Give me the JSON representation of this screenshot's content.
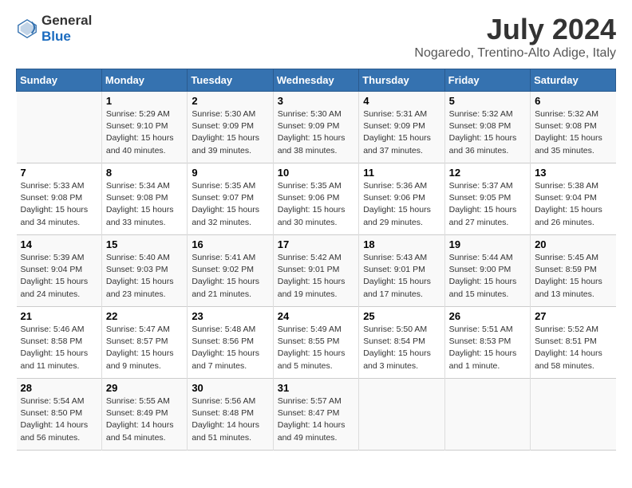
{
  "logo": {
    "general": "General",
    "blue": "Blue"
  },
  "title": "July 2024",
  "subtitle": "Nogaredo, Trentino-Alto Adige, Italy",
  "weekdays": [
    "Sunday",
    "Monday",
    "Tuesday",
    "Wednesday",
    "Thursday",
    "Friday",
    "Saturday"
  ],
  "weeks": [
    [
      {
        "day": "",
        "info": ""
      },
      {
        "day": "1",
        "info": "Sunrise: 5:29 AM\nSunset: 9:10 PM\nDaylight: 15 hours\nand 40 minutes."
      },
      {
        "day": "2",
        "info": "Sunrise: 5:30 AM\nSunset: 9:09 PM\nDaylight: 15 hours\nand 39 minutes."
      },
      {
        "day": "3",
        "info": "Sunrise: 5:30 AM\nSunset: 9:09 PM\nDaylight: 15 hours\nand 38 minutes."
      },
      {
        "day": "4",
        "info": "Sunrise: 5:31 AM\nSunset: 9:09 PM\nDaylight: 15 hours\nand 37 minutes."
      },
      {
        "day": "5",
        "info": "Sunrise: 5:32 AM\nSunset: 9:08 PM\nDaylight: 15 hours\nand 36 minutes."
      },
      {
        "day": "6",
        "info": "Sunrise: 5:32 AM\nSunset: 9:08 PM\nDaylight: 15 hours\nand 35 minutes."
      }
    ],
    [
      {
        "day": "7",
        "info": "Sunrise: 5:33 AM\nSunset: 9:08 PM\nDaylight: 15 hours\nand 34 minutes."
      },
      {
        "day": "8",
        "info": "Sunrise: 5:34 AM\nSunset: 9:08 PM\nDaylight: 15 hours\nand 33 minutes."
      },
      {
        "day": "9",
        "info": "Sunrise: 5:35 AM\nSunset: 9:07 PM\nDaylight: 15 hours\nand 32 minutes."
      },
      {
        "day": "10",
        "info": "Sunrise: 5:35 AM\nSunset: 9:06 PM\nDaylight: 15 hours\nand 30 minutes."
      },
      {
        "day": "11",
        "info": "Sunrise: 5:36 AM\nSunset: 9:06 PM\nDaylight: 15 hours\nand 29 minutes."
      },
      {
        "day": "12",
        "info": "Sunrise: 5:37 AM\nSunset: 9:05 PM\nDaylight: 15 hours\nand 27 minutes."
      },
      {
        "day": "13",
        "info": "Sunrise: 5:38 AM\nSunset: 9:04 PM\nDaylight: 15 hours\nand 26 minutes."
      }
    ],
    [
      {
        "day": "14",
        "info": "Sunrise: 5:39 AM\nSunset: 9:04 PM\nDaylight: 15 hours\nand 24 minutes."
      },
      {
        "day": "15",
        "info": "Sunrise: 5:40 AM\nSunset: 9:03 PM\nDaylight: 15 hours\nand 23 minutes."
      },
      {
        "day": "16",
        "info": "Sunrise: 5:41 AM\nSunset: 9:02 PM\nDaylight: 15 hours\nand 21 minutes."
      },
      {
        "day": "17",
        "info": "Sunrise: 5:42 AM\nSunset: 9:01 PM\nDaylight: 15 hours\nand 19 minutes."
      },
      {
        "day": "18",
        "info": "Sunrise: 5:43 AM\nSunset: 9:01 PM\nDaylight: 15 hours\nand 17 minutes."
      },
      {
        "day": "19",
        "info": "Sunrise: 5:44 AM\nSunset: 9:00 PM\nDaylight: 15 hours\nand 15 minutes."
      },
      {
        "day": "20",
        "info": "Sunrise: 5:45 AM\nSunset: 8:59 PM\nDaylight: 15 hours\nand 13 minutes."
      }
    ],
    [
      {
        "day": "21",
        "info": "Sunrise: 5:46 AM\nSunset: 8:58 PM\nDaylight: 15 hours\nand 11 minutes."
      },
      {
        "day": "22",
        "info": "Sunrise: 5:47 AM\nSunset: 8:57 PM\nDaylight: 15 hours\nand 9 minutes."
      },
      {
        "day": "23",
        "info": "Sunrise: 5:48 AM\nSunset: 8:56 PM\nDaylight: 15 hours\nand 7 minutes."
      },
      {
        "day": "24",
        "info": "Sunrise: 5:49 AM\nSunset: 8:55 PM\nDaylight: 15 hours\nand 5 minutes."
      },
      {
        "day": "25",
        "info": "Sunrise: 5:50 AM\nSunset: 8:54 PM\nDaylight: 15 hours\nand 3 minutes."
      },
      {
        "day": "26",
        "info": "Sunrise: 5:51 AM\nSunset: 8:53 PM\nDaylight: 15 hours\nand 1 minute."
      },
      {
        "day": "27",
        "info": "Sunrise: 5:52 AM\nSunset: 8:51 PM\nDaylight: 14 hours\nand 58 minutes."
      }
    ],
    [
      {
        "day": "28",
        "info": "Sunrise: 5:54 AM\nSunset: 8:50 PM\nDaylight: 14 hours\nand 56 minutes."
      },
      {
        "day": "29",
        "info": "Sunrise: 5:55 AM\nSunset: 8:49 PM\nDaylight: 14 hours\nand 54 minutes."
      },
      {
        "day": "30",
        "info": "Sunrise: 5:56 AM\nSunset: 8:48 PM\nDaylight: 14 hours\nand 51 minutes."
      },
      {
        "day": "31",
        "info": "Sunrise: 5:57 AM\nSunset: 8:47 PM\nDaylight: 14 hours\nand 49 minutes."
      },
      {
        "day": "",
        "info": ""
      },
      {
        "day": "",
        "info": ""
      },
      {
        "day": "",
        "info": ""
      }
    ]
  ]
}
